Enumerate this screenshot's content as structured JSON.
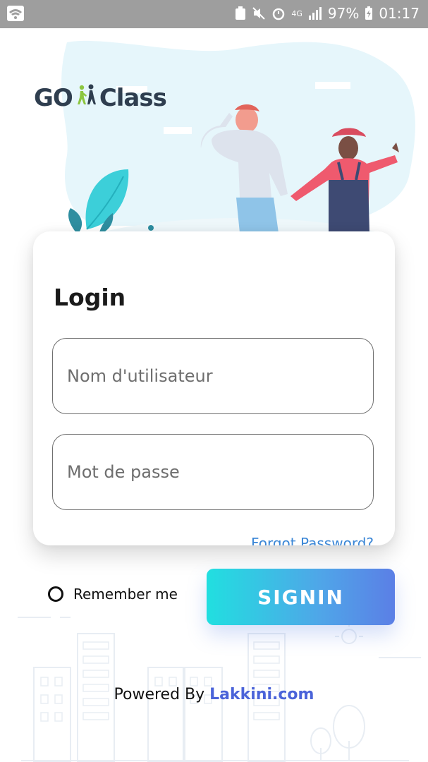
{
  "status_bar": {
    "battery": "97%",
    "time": "01:17",
    "network": "4G"
  },
  "app": {
    "logo_left": "GO",
    "logo_right": "Class"
  },
  "login": {
    "title": "Login",
    "username_placeholder": "Nom d'utilisateur",
    "password_placeholder": "Mot de passe",
    "forgot": "Forgot Password?",
    "remember": "Remember me",
    "signin": "SIGNIN"
  },
  "footer": {
    "prefix": "Powered By ",
    "brand": "Lakkini.com"
  },
  "colors": {
    "accent_start": "#21dfe0",
    "accent_end": "#5b7fe6",
    "brand": "#4a63d9",
    "link": "#3a86d6"
  }
}
